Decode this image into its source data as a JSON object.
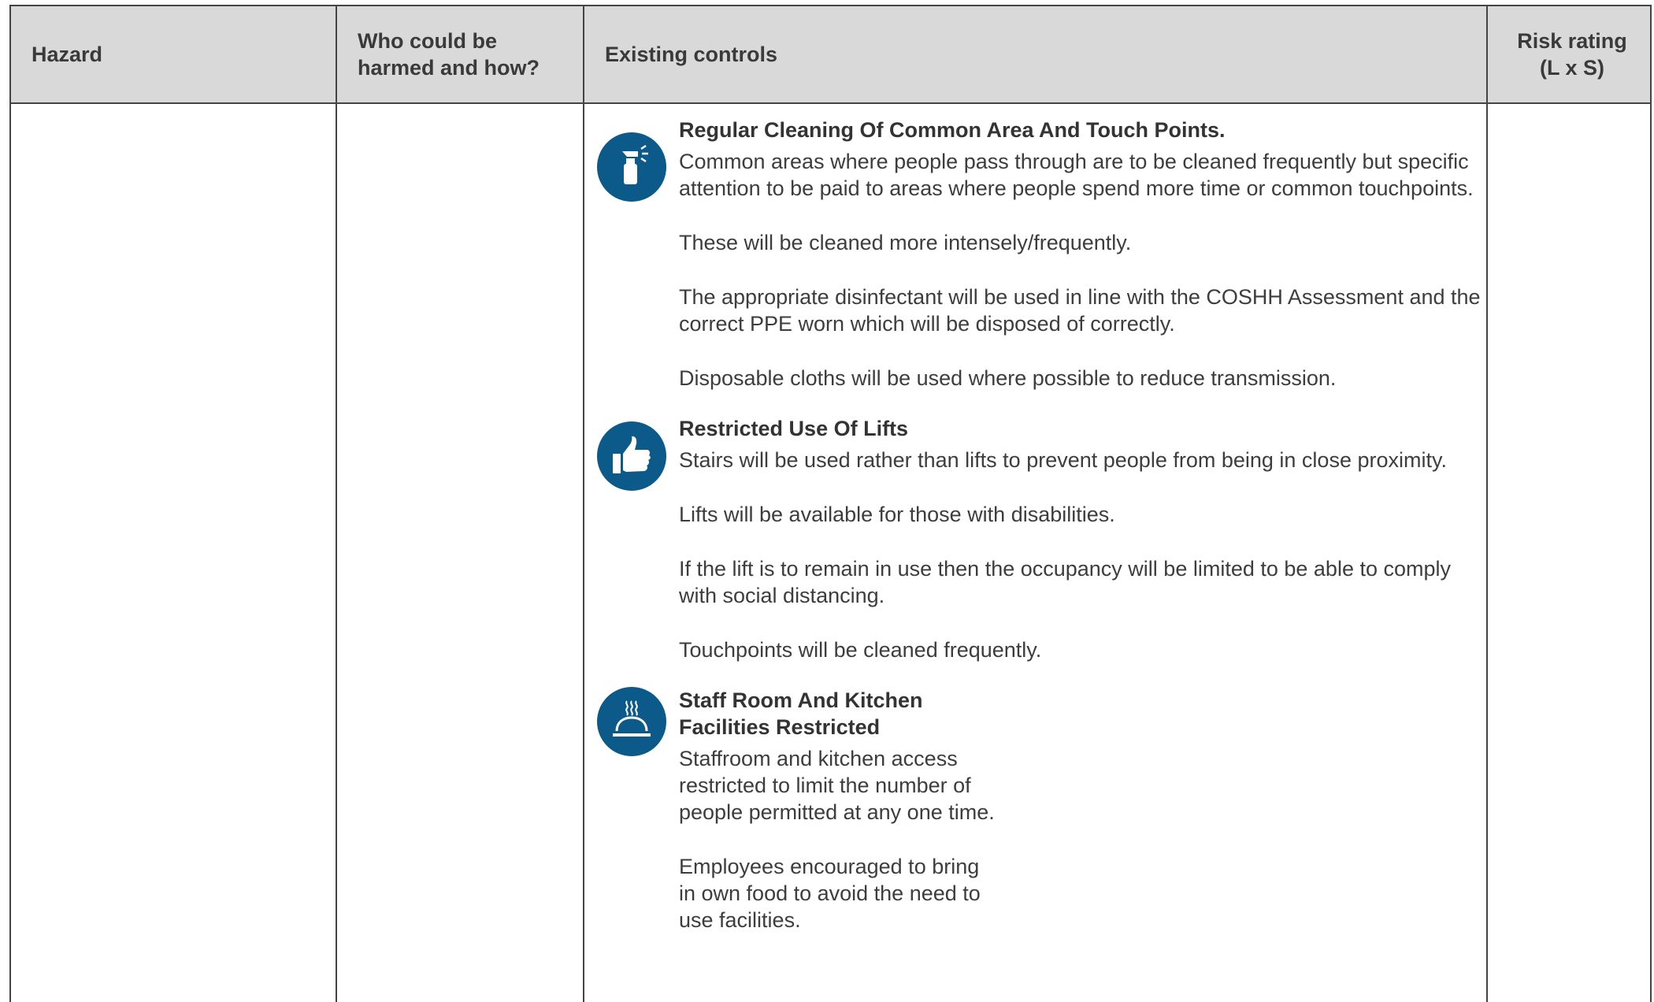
{
  "table": {
    "headers": {
      "hazard": "Hazard",
      "who": "Who could be\nharmed and how?",
      "controls": "Existing controls",
      "risk": "Risk rating\n(L x S)"
    }
  },
  "controls": [
    {
      "icon": "spray-bottle-icon",
      "title": "Regular Cleaning Of Common Area And Touch Points.",
      "paragraphs": [
        "Common areas where people pass through are to be cleaned frequently but specific attention to be paid to areas where people spend more time or common touchpoints.",
        "These will be cleaned more intensely/frequently.",
        "The appropriate disinfectant will be used in line with the COSHH Assessment and the correct PPE worn which will be disposed of correctly.",
        "Disposable cloths will be used where possible to reduce transmission."
      ]
    },
    {
      "icon": "thumbs-up-icon",
      "title": "Restricted Use Of Lifts",
      "paragraphs": [
        "Stairs will be used rather than lifts to prevent people from being in close proximity.",
        "Lifts will be available for those with disabilities.",
        "If the lift is to remain in use then the occupancy will be limited to be able to comply with social distancing.",
        "Touchpoints will be cleaned frequently."
      ]
    },
    {
      "icon": "food-cloche-icon",
      "title": "Staff Room And Kitchen\nFacilities Restricted",
      "paragraphs": [
        "Staffroom and kitchen access\nrestricted to limit the number of\npeople permitted at any one time.",
        "Employees encouraged to bring\nin own food to avoid the need to\nuse facilities."
      ]
    }
  ],
  "colors": {
    "header_bg": "#d9d9d9",
    "border": "#444444",
    "icon_bg": "#0c5a8a"
  }
}
